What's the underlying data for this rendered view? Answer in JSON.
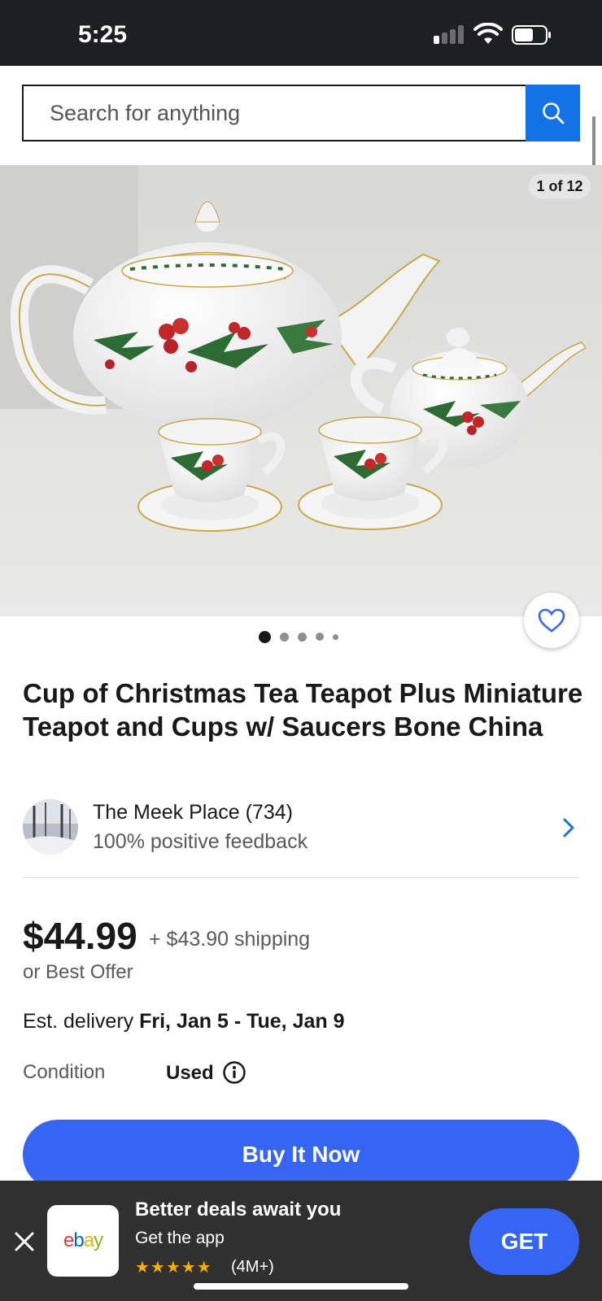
{
  "status_bar": {
    "time": "5:25"
  },
  "search": {
    "placeholder": "Search for anything"
  },
  "image": {
    "counter": "1 of 12",
    "total_dots": 5,
    "active_dot": 1
  },
  "product": {
    "title": "Cup of Christmas Tea Teapot Plus Miniature Teapot and Cups w/ Saucers Bone China"
  },
  "seller": {
    "name": "The Meek Place (734)",
    "feedback": "100% positive feedback"
  },
  "pricing": {
    "price": "$44.99",
    "shipping": "+ $43.90 shipping",
    "best_offer": "or Best Offer"
  },
  "delivery": {
    "label": "Est. delivery ",
    "dates": "Fri, Jan 5 - Tue, Jan 9"
  },
  "condition": {
    "label": "Condition",
    "value": "Used"
  },
  "actions": {
    "buy_now": "Buy It Now"
  },
  "app_banner": {
    "title": "Better deals await you",
    "subtitle": "Get the app",
    "stars": "★★★★★",
    "rating": "(4M+)",
    "get_label": "GET",
    "logo_letters": [
      "e",
      "b",
      "a",
      "y"
    ]
  },
  "colors": {
    "accent_blue": "#3665f3",
    "search_blue": "#1372e6",
    "star_yellow": "#f5af02",
    "logo_red": "#e53238",
    "logo_blue": "#0064d2",
    "logo_yellow": "#f5af02",
    "logo_green": "#86b817"
  }
}
